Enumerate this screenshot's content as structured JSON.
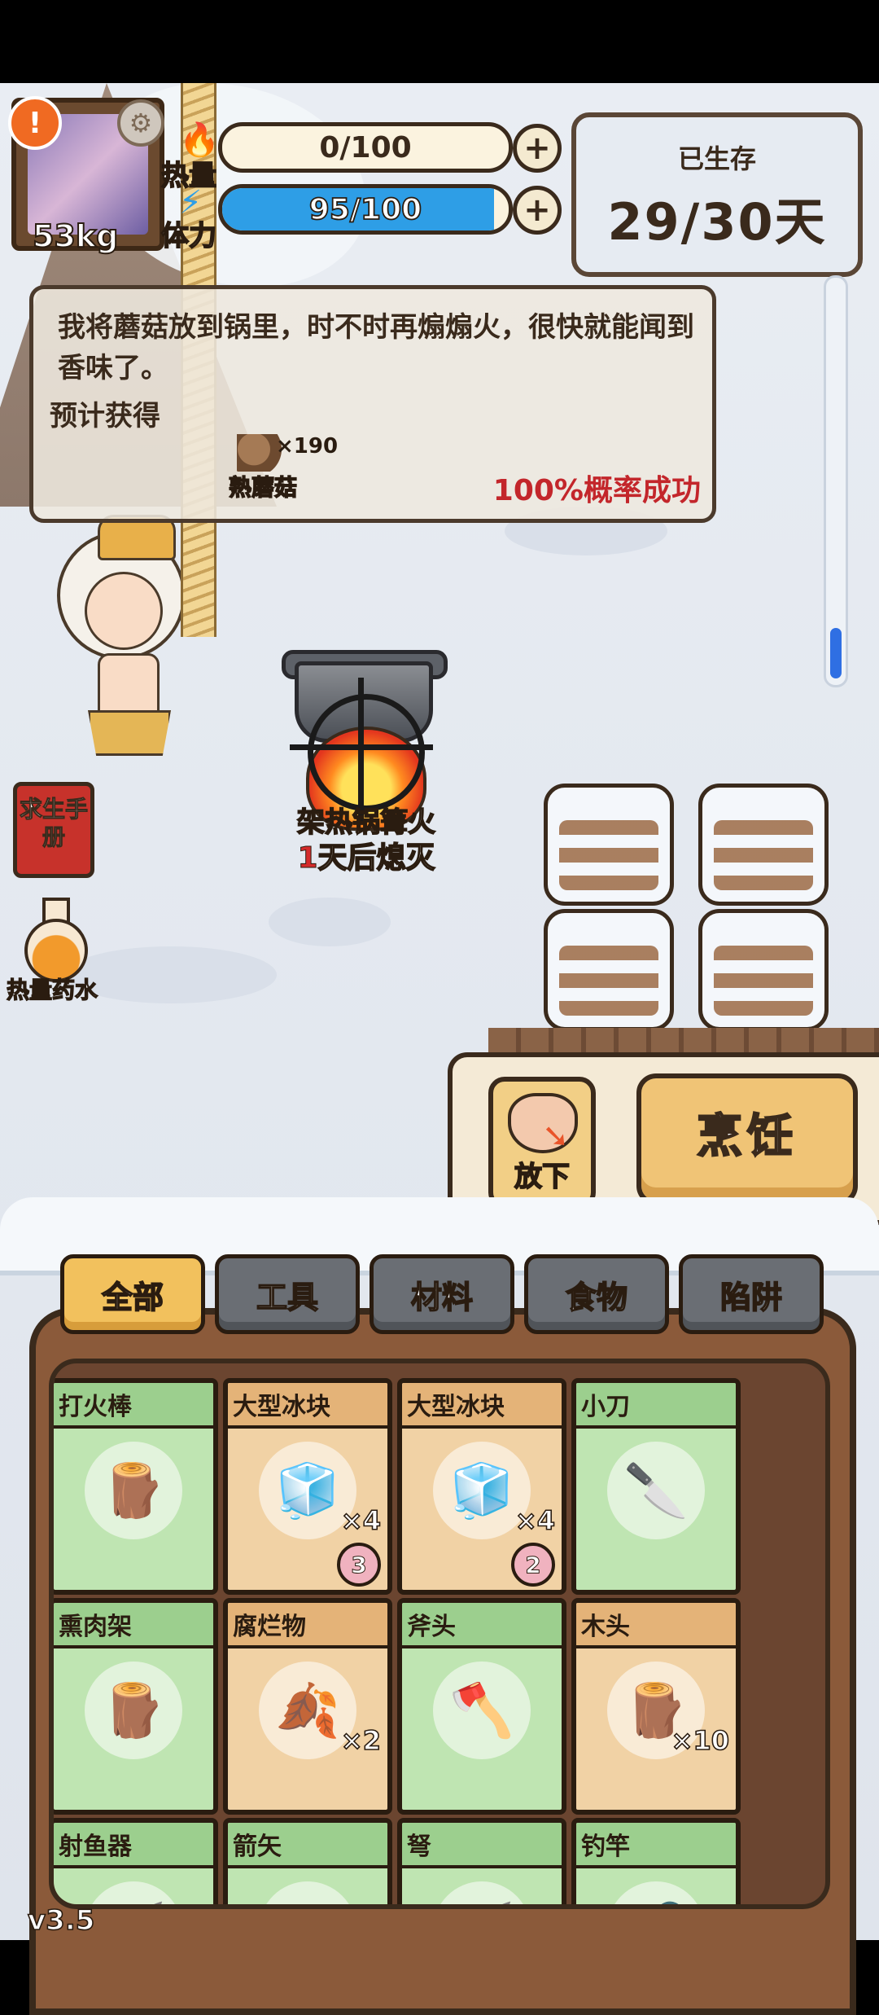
{
  "player": {
    "weight": "53kg",
    "alert_icon": "exclamation-icon",
    "settings_icon": "gear-icon"
  },
  "stats": {
    "heat": {
      "label": "热量",
      "value": "0/100",
      "fill_fraction": 0.0
    },
    "stamina": {
      "label": "体力",
      "value": "95/100",
      "fill_fraction": 0.95
    }
  },
  "survival": {
    "title": "已生存",
    "days": "29/30天"
  },
  "dialog": {
    "text": "我将蘑菇放到锅里，时不时再煽煽火，很快就能闻到香味了。",
    "expected_label": "预计获得",
    "reward_name": "熟蘑菇",
    "reward_count": "×190",
    "success_rate": "100%概率成功"
  },
  "fire": {
    "name": "架热锅篝火",
    "status_number": "1",
    "status_text": "天后熄灭"
  },
  "shortcuts": {
    "manual": "求生手册",
    "potion": "热量药水"
  },
  "actions": {
    "drop": "放下",
    "cook": "烹饪"
  },
  "tabs": [
    "全部",
    "工具",
    "材料",
    "食物",
    "陷阱"
  ],
  "items": [
    {
      "name": "打火棒",
      "count": "",
      "badge": "",
      "style": "green",
      "icon": "fire-stick-icon"
    },
    {
      "name": "大型冰块",
      "count": "×4",
      "badge": "3",
      "style": "tan",
      "icon": "ice-block-icon"
    },
    {
      "name": "大型冰块",
      "count": "×4",
      "badge": "2",
      "style": "tan",
      "icon": "ice-block-icon"
    },
    {
      "name": "小刀",
      "count": "",
      "badge": "",
      "style": "green",
      "icon": "knife-icon"
    },
    {
      "name": "熏肉架",
      "count": "",
      "badge": "",
      "style": "green",
      "icon": "smoking-rack-icon"
    },
    {
      "name": "腐烂物",
      "count": "×2",
      "badge": "",
      "style": "tan",
      "icon": "rotten-item-icon"
    },
    {
      "name": "斧头",
      "count": "",
      "badge": "",
      "style": "green",
      "icon": "axe-icon"
    },
    {
      "name": "木头",
      "count": "×10",
      "badge": "",
      "style": "tan",
      "icon": "wood-log-icon"
    },
    {
      "name": "射鱼器",
      "count": "",
      "badge": "",
      "style": "green",
      "icon": "fish-shooter-icon"
    },
    {
      "name": "箭矢",
      "count": "",
      "badge": "",
      "style": "green",
      "icon": "arrow-icon"
    },
    {
      "name": "弩",
      "count": "",
      "badge": "",
      "style": "green",
      "icon": "crossbow-icon"
    },
    {
      "name": "钓竿",
      "count": "",
      "badge": "",
      "style": "green",
      "icon": "fishing-rod-icon"
    }
  ],
  "version": "v3.5"
}
